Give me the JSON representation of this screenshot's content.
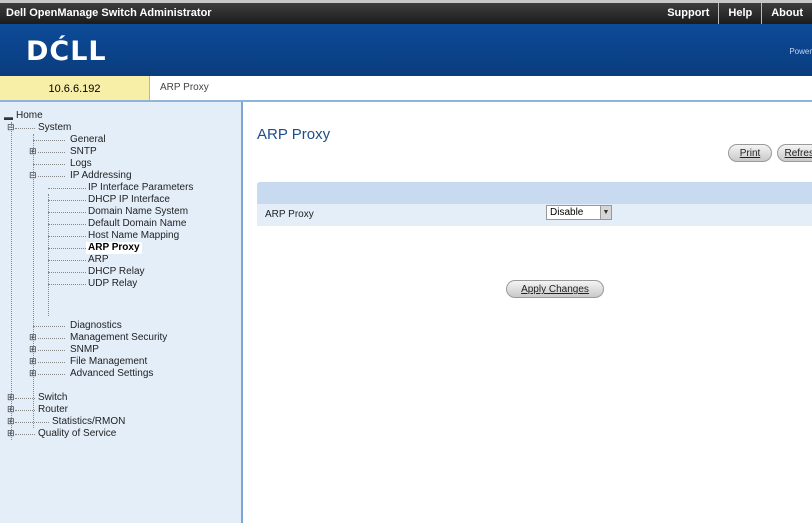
{
  "app": {
    "title": "Dell OpenManage Switch Administrator"
  },
  "top_links": {
    "support": "Support",
    "help": "Help",
    "about": "About"
  },
  "brand": {
    "logo": "DĆLL",
    "user_label": "Power"
  },
  "header": {
    "ip_address": "10.6.6.192",
    "breadcrumb": "ARP Proxy"
  },
  "tree": {
    "home": "Home",
    "system": "System",
    "general": "General",
    "snmp": "SNTP",
    "logs": "Logs",
    "ip_addressing": "IP Addressing",
    "ip_interface_parameters": "IP Interface Parameters",
    "dhcp_ip_interface": "DHCP IP Interface",
    "domain_name_system": "Domain Name System",
    "default_domain_name": "Default Domain Name",
    "host_name_mapping": "Host Name Mapping",
    "arp_proxy": "ARP Proxy",
    "arp": "ARP",
    "dhcp_relay": "DHCP Relay",
    "udp_relay": "UDP Relay",
    "diagnostics": "Diagnostics",
    "management_security": "Management Security",
    "snmp2": "SNMP",
    "file_management": "File Management",
    "advanced_settings": "Advanced Settings",
    "switch": "Switch",
    "router": "Router",
    "statistics_rmon": "Statistics/RMON",
    "quality_of_service": "Quality of Service"
  },
  "main": {
    "title": "ARP Proxy",
    "print_button": "Print",
    "refresh_button": "Refresh",
    "field_label": "ARP Proxy",
    "field_value": "Disable",
    "apply_button": "Apply Changes"
  },
  "colors": {
    "brand_blue": "#0c4b99",
    "sidebar_bg": "#e4eef9",
    "title_blue": "#1b4e8c",
    "ip_bar": "#f7efa7"
  }
}
